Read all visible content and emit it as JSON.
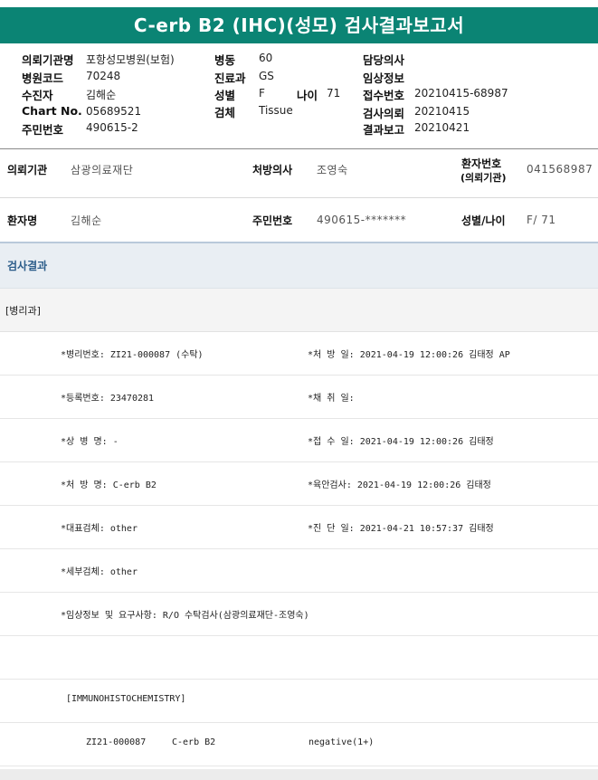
{
  "title": "C-erb B2 (IHC)(성모) 검사결과보고서",
  "header": {
    "hospital_label": "의뢰기관명",
    "hospital_value": "포항성모병원(보험)",
    "code_label": "병원코드",
    "code_value": "70248",
    "patient_label": "수진자",
    "patient_value": "김해순",
    "chart_label": "Chart No.",
    "chart_value": "05689521",
    "id_label": "주민번호",
    "id_value": "490615-2",
    "ward_label": "병동",
    "ward_value": "60",
    "dept_label": "진료과",
    "dept_value": "GS",
    "sex_label": "성별",
    "sex_value": "F",
    "age_label": "나이",
    "age_value": "71",
    "specimen_label": "검체",
    "specimen_value": "Tissue",
    "doctor_label": "담당의사",
    "clinical_label": "임상정보",
    "receipt_label": "접수번호",
    "receipt_value": "20210415-68987",
    "request_label": "검사의뢰",
    "request_value": "20210415",
    "report_label": "결과보고",
    "report_value": "20210421"
  },
  "info": {
    "org_label": "의뢰기관",
    "org_value": "삼광의료재단",
    "presc_label": "처방의사",
    "presc_value": "조영숙",
    "pno_label_1": "환자번호",
    "pno_label_2": "(의뢰기관)",
    "pno_value": "041568987",
    "name_label": "환자명",
    "name_value": "김해순",
    "rrn_label": "주민번호",
    "rrn_value": "490615-*******",
    "sexage_label": "성별/나이",
    "sexage_value": "F/ 71"
  },
  "result": {
    "section_title": "검사결과",
    "subsection": "[병리과]",
    "lines": {
      "path_no": "*병리번호: ZI21-000087 (수탁)",
      "presc_date": "*처 방 일: 2021-04-19 12:00:26  김태정 AP",
      "reg_no": "*등록번호: 23470281",
      "collect_date": "*채 취 일:",
      "disease": "*상 병 명: -",
      "receipt_date": "*접 수 일: 2021-04-19 12:00:26  김태정",
      "presc_name": "*처 방 명: C-erb B2",
      "gross_exam": "*육안검사: 2021-04-19 12:00:26  김태정",
      "rep_specimen": "*대표검체: other",
      "diag_date": "*진 단 일: 2021-04-21 10:57:37  김태정",
      "detail_specimen": "*세부검체: other",
      "clinical_info": "*임상정보 및 요구사항: R/O 수탁검사(삼광의료재단-조영숙)",
      "ihc_header": "[IMMUNOHISTOCHEMISTRY]",
      "ihc_no": "ZI21-000087",
      "ihc_marker": "C-erb B2",
      "ihc_result": "negative(1+)"
    }
  }
}
